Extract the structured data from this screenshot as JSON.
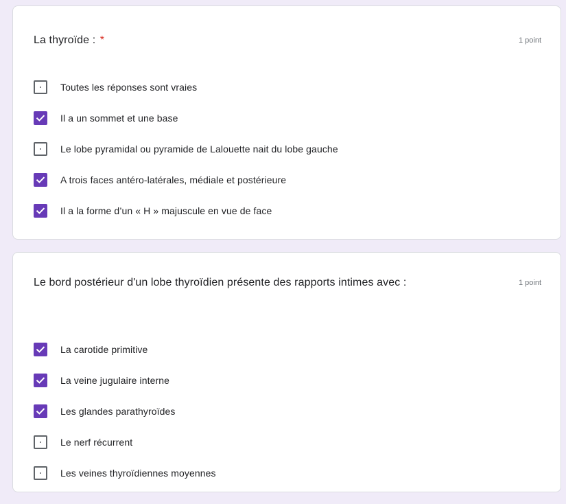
{
  "questions": [
    {
      "title": "La thyroïde :",
      "required_marker": "*",
      "points": "1 point",
      "options": [
        {
          "label": "Toutes les réponses sont vraies",
          "checked": false
        },
        {
          "label": "Il a un sommet et une base",
          "checked": true
        },
        {
          "label": "Le lobe pyramidal ou pyramide de Lalouette nait du lobe gauche",
          "checked": false
        },
        {
          "label": "A trois faces antéro-latérales, médiale et postérieure",
          "checked": true
        },
        {
          "label": "Il a la forme d’un « H » majuscule en vue de face",
          "checked": true
        }
      ]
    },
    {
      "title": "Le bord postérieur d'un lobe thyroïdien présente des rapports intimes avec :",
      "points": "1 point",
      "options": [
        {
          "label": "La carotide primitive",
          "checked": true
        },
        {
          "label": "La veine jugulaire interne",
          "checked": true
        },
        {
          "label": "Les glandes parathyroïdes",
          "checked": true
        },
        {
          "label": "Le nerf récurrent",
          "checked": false
        },
        {
          "label": "Les veines thyroïdiennes moyennes",
          "checked": false
        }
      ]
    }
  ],
  "colors": {
    "background": "#f0ebf8",
    "checked_box": "#673ab7",
    "required": "#d93025"
  },
  "icons": {
    "checked": "checkmark-icon",
    "unchecked": "empty-checkbox"
  }
}
